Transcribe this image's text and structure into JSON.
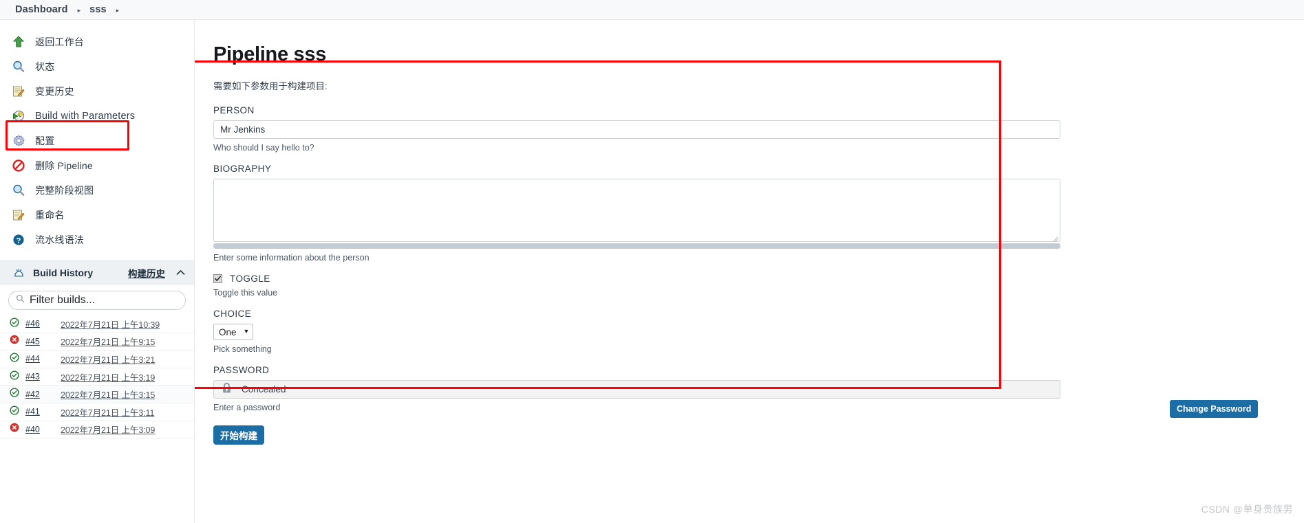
{
  "breadcrumb": {
    "items": [
      {
        "label": "Dashboard"
      },
      {
        "label": "sss"
      }
    ],
    "separator": "▸"
  },
  "sidebar": {
    "tasks": [
      {
        "label": "返回工作台",
        "icon": "up-arrow-icon",
        "cn": true
      },
      {
        "label": "状态",
        "icon": "magnifier-icon",
        "cn": true
      },
      {
        "label": "变更历史",
        "icon": "notepad-edit-icon",
        "cn": true
      },
      {
        "label": "Build with Parameters",
        "icon": "clock-play-icon",
        "cn": false
      },
      {
        "label": "配置",
        "icon": "gear-icon",
        "cn": true
      },
      {
        "label": "删除 Pipeline",
        "icon": "delete-icon",
        "cn": true
      },
      {
        "label": "完整阶段视图",
        "icon": "magnifier-icon",
        "cn": true
      },
      {
        "label": "重命名",
        "icon": "notepad-edit-icon",
        "cn": true
      },
      {
        "label": "流水线语法",
        "icon": "help-icon",
        "cn": true
      }
    ],
    "build_history": {
      "title": "Build History",
      "link_label": "构建历史",
      "collapse_icon": "chevron-up-icon",
      "filter_placeholder": "Filter builds...",
      "rows": [
        {
          "number": "#46",
          "date": "2022年7月21日 上午10:39",
          "status": "success"
        },
        {
          "number": "#45",
          "date": "2022年7月21日 上午9:15",
          "status": "failed"
        },
        {
          "number": "#44",
          "date": "2022年7月21日 上午3:21",
          "status": "success"
        },
        {
          "number": "#43",
          "date": "2022年7月21日 上午3:19",
          "status": "success"
        },
        {
          "number": "#42",
          "date": "2022年7月21日 上午3:15",
          "status": "success"
        },
        {
          "number": "#41",
          "date": "2022年7月21日 上午3:11",
          "status": "success"
        },
        {
          "number": "#40",
          "date": "2022年7月21日 上午3:09",
          "status": "failed"
        }
      ]
    }
  },
  "main": {
    "title": "Pipeline sss",
    "description": "需要如下参数用于构建项目:",
    "params": {
      "person": {
        "label": "PERSON",
        "value": "Mr Jenkins",
        "description": "Who should I say hello to?"
      },
      "biography": {
        "label": "BIOGRAPHY",
        "value": "",
        "description": "Enter some information about the person"
      },
      "toggle": {
        "label": "TOGGLE",
        "checked": true,
        "description": "Toggle this value"
      },
      "choice": {
        "label": "CHOICE",
        "selected": "One",
        "description": "Pick something"
      },
      "password": {
        "label": "PASSWORD",
        "value": "Concealed",
        "description": "Enter a password",
        "change_button_label": "Change Password"
      }
    },
    "submit_label": "开始构建"
  },
  "watermark": "CSDN @单身贵族男",
  "colors": {
    "accent_blue": "#1b6ea5",
    "highlight_red": "#fb0007",
    "success_green": "#1f7a32",
    "failure_red": "#d9312b"
  }
}
